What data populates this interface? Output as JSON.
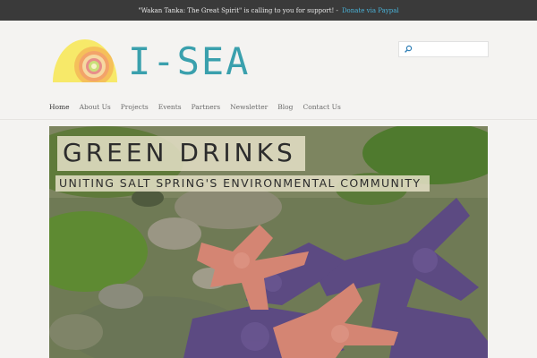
{
  "announcement": {
    "message": "\"Wakan Tanka: The Great Spirit\" is calling to you for support! -",
    "donate_link": "Donate via Paypal"
  },
  "brand": {
    "logo_text": "I-SEA"
  },
  "search": {
    "value": "",
    "placeholder": ""
  },
  "nav": {
    "items": [
      {
        "label": "Home",
        "active": true
      },
      {
        "label": "About Us"
      },
      {
        "label": "Projects"
      },
      {
        "label": "Events"
      },
      {
        "label": "Partners"
      },
      {
        "label": "Newsletter"
      },
      {
        "label": "Blog"
      },
      {
        "label": "Contact Us"
      }
    ]
  },
  "hero": {
    "title": "GREEN DRINKS",
    "subtitle": "UNITING SALT SPRING'S ENVIRONMENTAL COMMUNITY"
  },
  "colors": {
    "topbar_bg": "#3a3a3a",
    "link_accent": "#4ab3d8",
    "logo_text": "#3aa0ad",
    "page_bg": "#f4f3f1"
  }
}
